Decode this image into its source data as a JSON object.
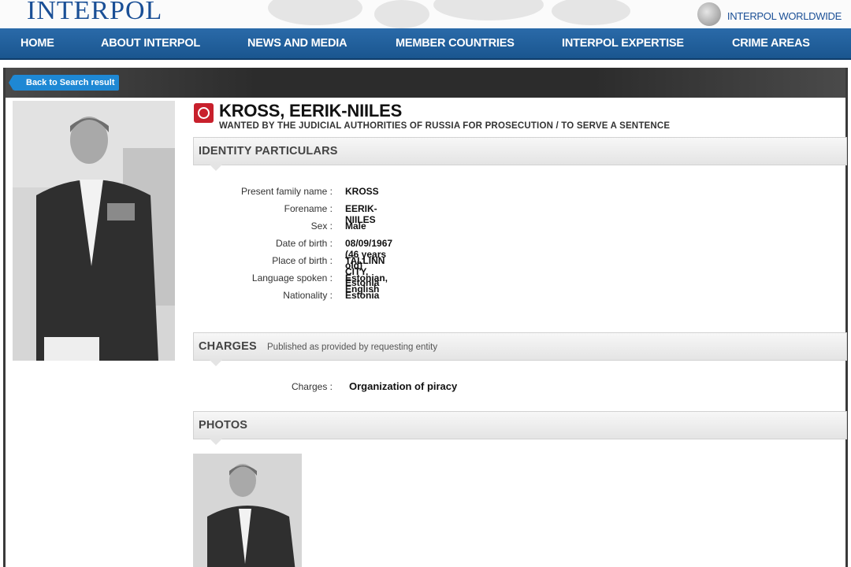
{
  "header": {
    "logo": "INTERPOL",
    "worldwide": "INTERPOL WORLDWIDE"
  },
  "nav": [
    "HOME",
    "ABOUT INTERPOL",
    "NEWS AND MEDIA",
    "MEMBER COUNTRIES",
    "INTERPOL EXPERTISE",
    "CRIME AREAS"
  ],
  "back_label": "Back to Search result",
  "person": {
    "name": "KROSS, EERIK-NIILES",
    "wanted": "WANTED BY THE JUDICIAL AUTHORITIES OF RUSSIA FOR PROSECUTION / TO SERVE A SENTENCE"
  },
  "identity": {
    "title": "IDENTITY PARTICULARS",
    "rows": [
      {
        "label": "Present family name :",
        "value": "KROSS"
      },
      {
        "label": "Forename :",
        "value": "EERIK-NIILES"
      },
      {
        "label": "Sex :",
        "value": "Male"
      },
      {
        "label": "Date of birth :",
        "value": "08/09/1967 (46 years old)"
      },
      {
        "label": "Place of birth :",
        "value": "TALLINN CITY, Estonia"
      },
      {
        "label": "Language spoken :",
        "value": "Estonian, English"
      },
      {
        "label": "Nationality :",
        "value": "Estonia"
      }
    ]
  },
  "charges": {
    "title": "CHARGES",
    "note": "Published as provided by requesting entity",
    "label": "Charges :",
    "value": "Organization of piracy"
  },
  "photos": {
    "title": "PHOTOS"
  },
  "colors": {
    "nav_blue": "#1f5f9f",
    "logo_blue": "#1a4f96",
    "back_blue": "#1e88d4",
    "emblem_red": "#c8202c"
  }
}
